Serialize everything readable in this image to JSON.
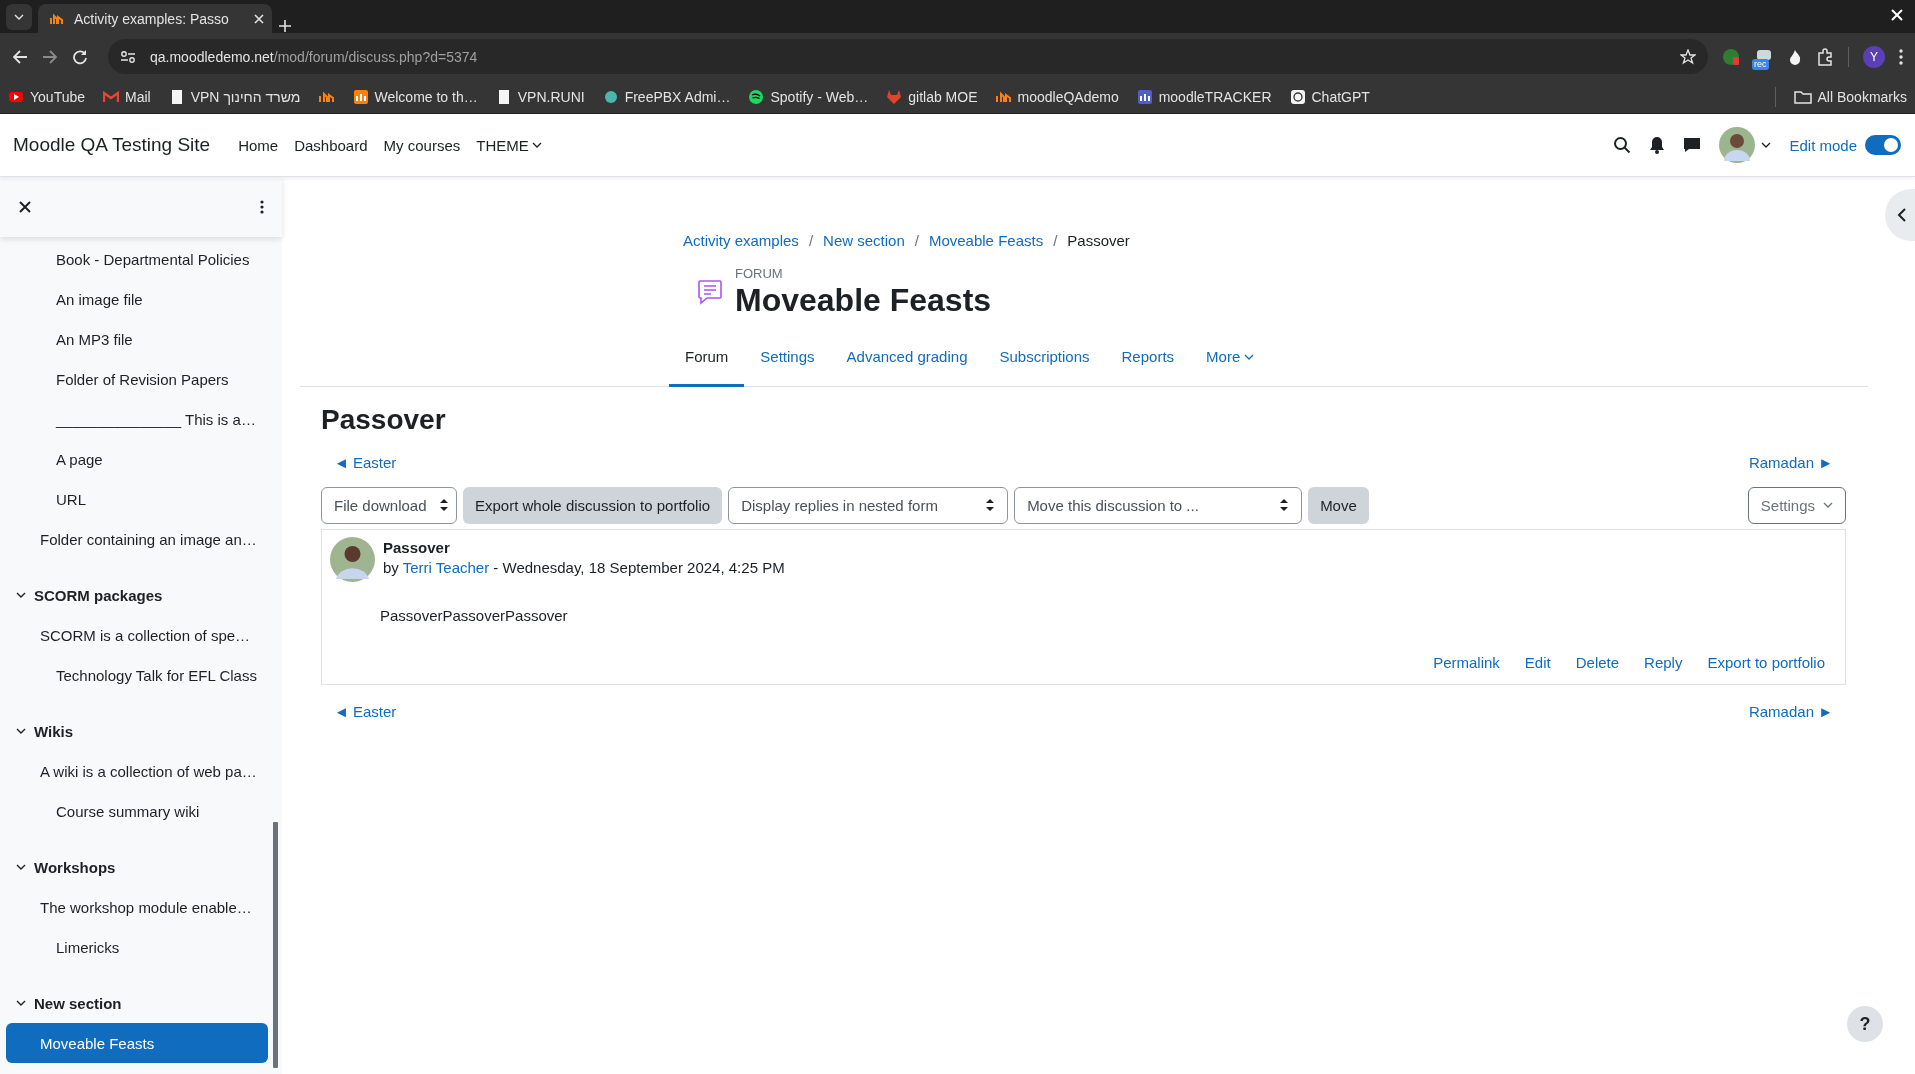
{
  "browser": {
    "tabs": [
      {
        "title": "Activity examples: Passo",
        "selected": true
      }
    ],
    "url": {
      "host": "qa.moodledemo.net",
      "path": "/mod/forum/discuss.php?d=5374"
    },
    "bookmarks": [
      {
        "kind": "labeled",
        "label": "YouTube"
      },
      {
        "kind": "labeled",
        "label": "Mail"
      },
      {
        "kind": "labeled",
        "label": "VPN משרד החינוך"
      },
      {
        "kind": "icon_only"
      },
      {
        "kind": "labeled",
        "label": "Welcome to th…"
      },
      {
        "kind": "labeled",
        "label": "VPN.RUNI"
      },
      {
        "kind": "labeled",
        "label": "FreePBX Admi…"
      },
      {
        "kind": "labeled",
        "label": "Spotify - Web…"
      },
      {
        "kind": "labeled",
        "label": "gitlab MOE"
      },
      {
        "kind": "labeled",
        "label": "moodleQAdemo"
      },
      {
        "kind": "labeled",
        "label": "moodleTRACKER"
      },
      {
        "kind": "labeled",
        "label": "ChatGPT"
      }
    ],
    "all_bookmarks": "All Bookmarks",
    "extension_badge": "rec",
    "profile_initial": "Y"
  },
  "navbar": {
    "site_name": "Moodle QA Testing Site",
    "links": [
      {
        "kind": "link",
        "label": "Home"
      },
      {
        "kind": "link",
        "label": "Dashboard"
      },
      {
        "kind": "link",
        "label": "My courses"
      },
      {
        "kind": "menu",
        "label": "THEME"
      }
    ],
    "edit_mode": {
      "label": "Edit mode",
      "on": true
    }
  },
  "course_index": {
    "groups": [
      {
        "items": [
          {
            "label": "Book - Departmental Policies",
            "indented": true,
            "selected": false
          },
          {
            "label": "An image file",
            "indented": true,
            "selected": false
          },
          {
            "label": "An MP3 file",
            "indented": true,
            "selected": false
          },
          {
            "label": "Folder of Revision Papers",
            "indented": true,
            "selected": false
          },
          {
            "label": "_______________ This is a…",
            "indented": true,
            "selected": false
          },
          {
            "label": "A page",
            "indented": true,
            "selected": false
          },
          {
            "label": "URL",
            "indented": true,
            "selected": false
          },
          {
            "label": "Folder containing an image an…",
            "indented": false,
            "selected": false
          }
        ]
      },
      {
        "title": "SCORM packages",
        "expanded": true,
        "items": [
          {
            "label": "SCORM is a collection of spe…",
            "indented": false,
            "selected": false
          },
          {
            "label": "Technology Talk for EFL Class",
            "indented": true,
            "selected": false
          }
        ]
      },
      {
        "title": "Wikis",
        "expanded": true,
        "items": [
          {
            "label": "A wiki is a collection of web pa…",
            "indented": false,
            "selected": false
          },
          {
            "label": "Course summary wiki",
            "indented": true,
            "selected": false
          }
        ]
      },
      {
        "title": "Workshops",
        "expanded": true,
        "items": [
          {
            "label": "The workshop module enable…",
            "indented": false,
            "selected": false
          },
          {
            "label": "Limericks",
            "indented": true,
            "selected": false
          }
        ]
      },
      {
        "title": "New section",
        "expanded": true,
        "items": [
          {
            "label": "Moveable Feasts",
            "indented": false,
            "selected": true
          }
        ]
      }
    ]
  },
  "page": {
    "breadcrumb_separator": "/",
    "breadcrumb": [
      {
        "kind": "link",
        "label": "Activity examples"
      },
      {
        "kind": "link",
        "label": "New section"
      },
      {
        "kind": "link",
        "label": "Moveable Feasts"
      },
      {
        "kind": "current",
        "label": "Passover"
      }
    ],
    "module_type": "FORUM",
    "title": "Moveable Feasts",
    "tabs": [
      {
        "kind": "link",
        "label": "Forum",
        "selected": true
      },
      {
        "kind": "link",
        "label": "Settings",
        "selected": false
      },
      {
        "kind": "link",
        "label": "Advanced grading",
        "selected": false
      },
      {
        "kind": "link",
        "label": "Subscriptions",
        "selected": false
      },
      {
        "kind": "link",
        "label": "Reports",
        "selected": false
      },
      {
        "kind": "menu",
        "label": "More",
        "selected": false
      }
    ],
    "discussion": {
      "title": "Passover",
      "prev": "◄ Easter",
      "next": "Ramadan ►",
      "toolbar": [
        {
          "kind": "select",
          "label": "File download"
        },
        {
          "kind": "button",
          "label": "Export whole discussion to portfolio"
        },
        {
          "kind": "select",
          "label": "Display replies in nested form"
        },
        {
          "kind": "select",
          "label": "Move this discussion to ..."
        },
        {
          "kind": "button",
          "label": "Move"
        }
      ],
      "settings": "Settings",
      "post": {
        "subject": "Passover",
        "by": "by",
        "author": "Terri Teacher",
        "date": "- Wednesday, 18 September 2024, 4:25 PM",
        "body": "PassoverPassoverPassover",
        "actions": [
          "Permalink",
          "Edit",
          "Delete",
          "Reply",
          "Export to portfolio"
        ]
      },
      "bottom_prev": "◄ Easter",
      "bottom_next": "Ramadan ►"
    }
  },
  "help_button": "?"
}
